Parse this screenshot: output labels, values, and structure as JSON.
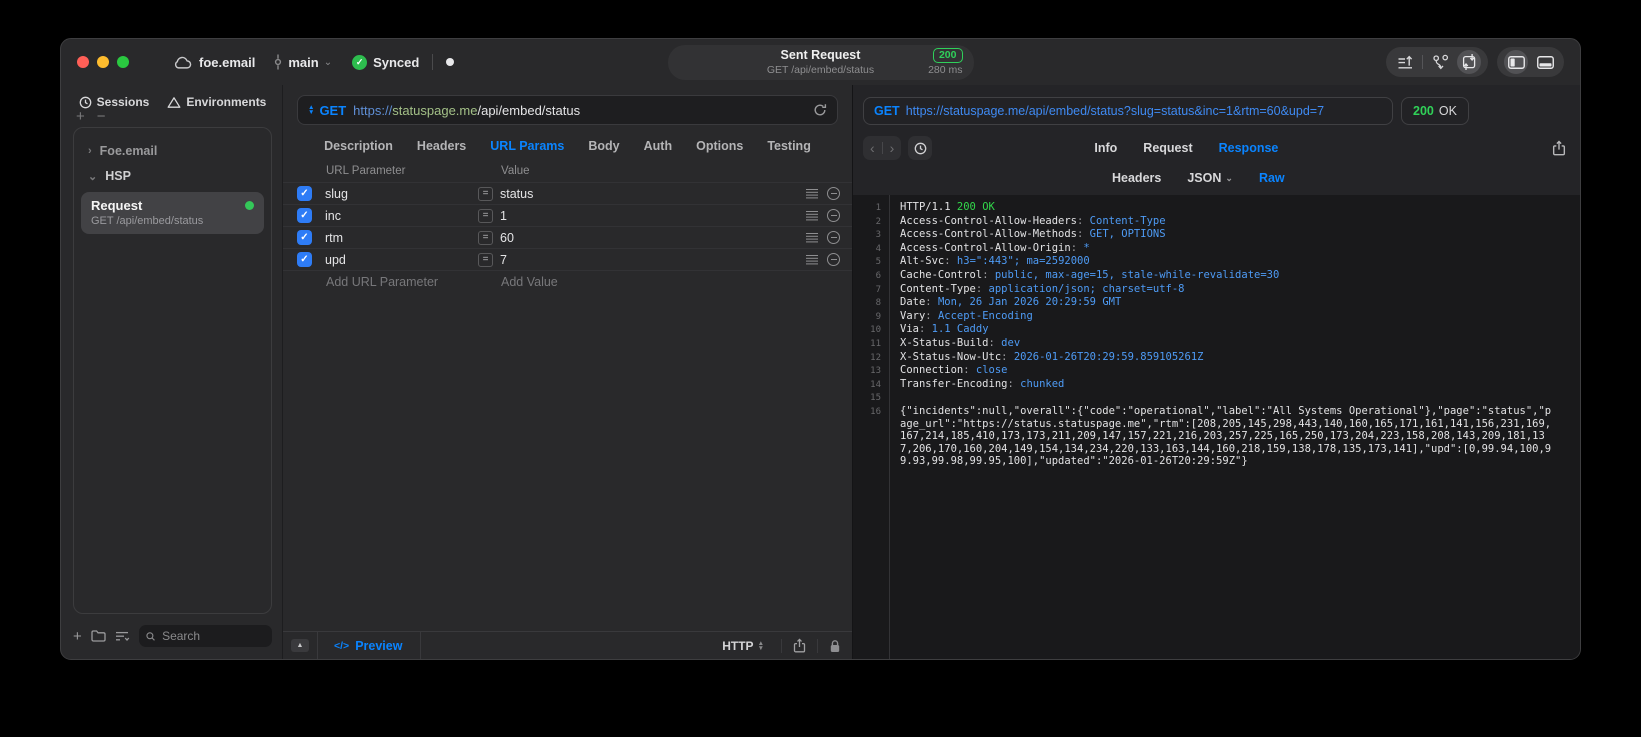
{
  "window": {
    "titlebar": {
      "project": "foe.email",
      "branch": "main",
      "sync_label": "Synced",
      "request_summary": {
        "title": "Sent Request",
        "subtitle": "GET /api/embed/status",
        "status_code": "200",
        "duration": "280 ms"
      }
    }
  },
  "sidebar": {
    "tabs": [
      {
        "label": "Sessions",
        "icon": "history-icon"
      },
      {
        "label": "Environments",
        "icon": "environments-icon"
      }
    ],
    "add_label": "+",
    "remove_label": "−",
    "tree": {
      "groups": [
        {
          "label": "Foe.email",
          "state": "collapsed",
          "disclosure": "›"
        },
        {
          "label": "HSP",
          "state": "expanded",
          "disclosure": "⌄"
        }
      ],
      "selected_request": {
        "title": "Request",
        "subtitle": "GET /api/embed/status"
      }
    },
    "search": {
      "placeholder": "Search"
    }
  },
  "request_panel": {
    "method": "GET",
    "url": {
      "scheme": "https://",
      "host": "statuspage.me",
      "path": "/api/embed/status"
    },
    "tabs": [
      "Description",
      "Headers",
      "URL Params",
      "Body",
      "Auth",
      "Options",
      "Testing"
    ],
    "active_tab": "URL Params",
    "params_table": {
      "columns": [
        "URL Parameter",
        "Value"
      ],
      "rows": [
        {
          "enabled": true,
          "name": "slug",
          "operator": "=",
          "value": "status"
        },
        {
          "enabled": true,
          "name": "inc",
          "operator": "=",
          "value": "1"
        },
        {
          "enabled": true,
          "name": "rtm",
          "operator": "=",
          "value": "60"
        },
        {
          "enabled": true,
          "name": "upd",
          "operator": "=",
          "value": "7"
        }
      ],
      "add_parameter_label": "Add URL Parameter",
      "add_value_label": "Add Value"
    },
    "footer": {
      "preview_label": "Preview",
      "code_glyph": "</>",
      "protocol": "HTTP"
    }
  },
  "response_panel": {
    "request_line": {
      "method": "GET",
      "url": "https://statuspage.me/api/embed/status?slug=status&inc=1&rtm=60&upd=7"
    },
    "status": {
      "code": "200",
      "text": "OK"
    },
    "tabs": [
      "Info",
      "Request",
      "Response"
    ],
    "active_tab": "Response",
    "subtabs": [
      {
        "label": "Headers",
        "dropdown": false
      },
      {
        "label": "JSON",
        "dropdown": true
      },
      {
        "label": "Raw",
        "dropdown": false
      }
    ],
    "active_subtab": "Raw",
    "code": {
      "lines": [
        {
          "n": "1",
          "parts": [
            {
              "t": "HTTP/1.1 ",
              "c": "w"
            },
            {
              "t": "200 OK",
              "c": "g"
            }
          ]
        },
        {
          "n": "2",
          "parts": [
            {
              "t": "Access-Control-Allow-Headers",
              "c": "w"
            },
            {
              "t": ": ",
              "c": "d"
            },
            {
              "t": "Content-Type",
              "c": "b"
            }
          ]
        },
        {
          "n": "3",
          "parts": [
            {
              "t": "Access-Control-Allow-Methods",
              "c": "w"
            },
            {
              "t": ": ",
              "c": "d"
            },
            {
              "t": "GET, OPTIONS",
              "c": "b"
            }
          ]
        },
        {
          "n": "4",
          "parts": [
            {
              "t": "Access-Control-Allow-Origin",
              "c": "w"
            },
            {
              "t": ": ",
              "c": "d"
            },
            {
              "t": "*",
              "c": "b"
            }
          ]
        },
        {
          "n": "5",
          "parts": [
            {
              "t": "Alt-Svc",
              "c": "w"
            },
            {
              "t": ": ",
              "c": "d"
            },
            {
              "t": "h3=\":443\"; ma=2592000",
              "c": "b"
            }
          ]
        },
        {
          "n": "6",
          "parts": [
            {
              "t": "Cache-Control",
              "c": "w"
            },
            {
              "t": ": ",
              "c": "d"
            },
            {
              "t": "public, max-age=15, stale-while-revalidate=30",
              "c": "b"
            }
          ]
        },
        {
          "n": "7",
          "parts": [
            {
              "t": "Content-Type",
              "c": "w"
            },
            {
              "t": ": ",
              "c": "d"
            },
            {
              "t": "application/json; charset=utf-8",
              "c": "b"
            }
          ]
        },
        {
          "n": "8",
          "parts": [
            {
              "t": "Date",
              "c": "w"
            },
            {
              "t": ": ",
              "c": "d"
            },
            {
              "t": "Mon, 26 Jan 2026 20:29:59 GMT",
              "c": "b"
            }
          ]
        },
        {
          "n": "9",
          "parts": [
            {
              "t": "Vary",
              "c": "w"
            },
            {
              "t": ": ",
              "c": "d"
            },
            {
              "t": "Accept-Encoding",
              "c": "b"
            }
          ]
        },
        {
          "n": "10",
          "parts": [
            {
              "t": "Via",
              "c": "w"
            },
            {
              "t": ": ",
              "c": "d"
            },
            {
              "t": "1.1 Caddy",
              "c": "b"
            }
          ]
        },
        {
          "n": "11",
          "parts": [
            {
              "t": "X-Status-Build",
              "c": "w"
            },
            {
              "t": ": ",
              "c": "d"
            },
            {
              "t": "dev",
              "c": "b"
            }
          ]
        },
        {
          "n": "12",
          "parts": [
            {
              "t": "X-Status-Now-Utc",
              "c": "w"
            },
            {
              "t": ": ",
              "c": "d"
            },
            {
              "t": "2026-01-26T20:29:59.859105261Z",
              "c": "b"
            }
          ]
        },
        {
          "n": "13",
          "parts": [
            {
              "t": "Connection",
              "c": "w"
            },
            {
              "t": ": ",
              "c": "d"
            },
            {
              "t": "close",
              "c": "b"
            }
          ]
        },
        {
          "n": "14",
          "parts": [
            {
              "t": "Transfer-Encoding",
              "c": "w"
            },
            {
              "t": ": ",
              "c": "d"
            },
            {
              "t": "chunked",
              "c": "b"
            }
          ]
        },
        {
          "n": "15",
          "parts": []
        },
        {
          "n": "16",
          "parts": [
            {
              "t": "{\"incidents\":null,\"overall\":{\"code\":\"operational\",\"label\":\"All Systems Operational\"},\"page\":\"status\",\"page_url\":\"https://status.statuspage.me\",\"rtm\":[208,205,145,298,443,140,160,165,171,161,141,156,231,169,167,214,185,410,173,173,211,209,147,157,221,216,203,257,225,165,250,173,204,223,158,208,143,209,181,137,206,170,160,204,149,154,134,234,220,133,163,144,160,218,159,138,178,135,173,141],\"upd\":[0,99.94,100,99.93,99.98,99.95,100],\"updated\":\"2026-01-26T20:29:59Z\"}",
              "c": "w"
            }
          ]
        }
      ]
    }
  },
  "icons": {
    "cloud-icon": "cloud outline",
    "branch-icon": "git commit line",
    "synced-check-icon": "✓",
    "unsaved-indicator-dot": "•",
    "history-icon": "clock",
    "environments-icon": "triangle",
    "method-stepper-icon": "▲▼",
    "refresh-icon": "circular arrow",
    "reorder-icon": "≡",
    "remove-row-icon": "⊖",
    "expand-editor-icon": "▲",
    "share-icon": "box with up arrow",
    "lock-icon": "padlock",
    "search-icon": "magnifier",
    "back-icon": "‹",
    "forward-icon": "›",
    "import-export-icon": "lines with up arrow",
    "merge-icon": "fork merge",
    "sync-window-icon": "box with arrows",
    "panel-left-icon": "sidebar toggle",
    "panel-bottom-icon": "bottom bar toggle"
  },
  "colors": {
    "accent": "#0a84ff",
    "success": "#30d158",
    "url_host_green": "#a3c087",
    "code_value_blue": "#4e9bf5",
    "checkbox_blue": "#2e7cf6"
  }
}
